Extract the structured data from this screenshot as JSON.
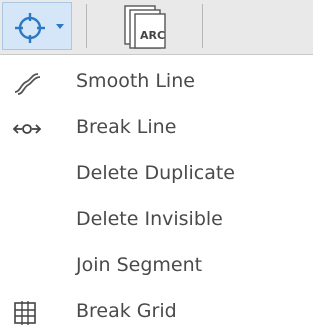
{
  "colors": {
    "accent": "#2b78c4",
    "toolbar_bg": "#e9e9e9",
    "button_highlight": "#d4e6f7",
    "text": "#4a4a4a"
  },
  "toolbar": {
    "primary_tool_icon": "selection-target-icon",
    "dropdown_icon": "chevron-down-icon",
    "arc_tool_icon": "stacked-layers-arc-icon",
    "arc_tool_label": "ARC"
  },
  "menu": {
    "items": [
      {
        "label": "Smooth Line",
        "icon": "smooth-line-icon"
      },
      {
        "label": "Break Line",
        "icon": "break-line-icon"
      },
      {
        "label": "Delete Duplicate",
        "icon": ""
      },
      {
        "label": "Delete Invisible",
        "icon": ""
      },
      {
        "label": "Join Segment",
        "icon": ""
      },
      {
        "label": "Break Grid",
        "icon": "break-grid-icon"
      }
    ]
  }
}
